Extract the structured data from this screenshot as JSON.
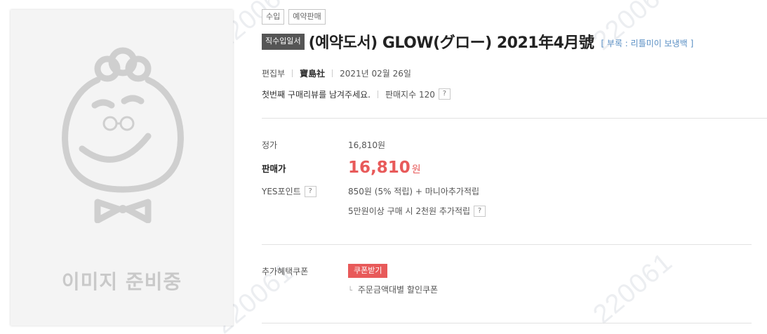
{
  "watermark": "220061",
  "cover": {
    "placeholder_text": "이미지 준비중"
  },
  "badges": [
    "수입",
    "예약판매"
  ],
  "title_block": {
    "tag": "직수입일서",
    "title": "(예약도서) GLOW(グロー) 2021年4月號",
    "subtitle": "[ 부록 : 리틀미이 보냉백 ]"
  },
  "meta": {
    "author": "편집부",
    "publisher": "寶島社",
    "date": "2021년 02월 26일"
  },
  "review": {
    "link": "첫번째 구매리뷰를 남겨주세요.",
    "sales_index": "판매지수 120",
    "help": "?"
  },
  "pricing": {
    "list_label": "정가",
    "list_price": "16,810원",
    "sale_label": "판매가",
    "sale_price": "16,810",
    "sale_unit": "원",
    "points_label": "YES포인트",
    "points_help": "?",
    "points_value": "850원 (5% 적립) + 마니아추가적립",
    "points_extra": "5만원이상 구매 시 2천원 추가적립",
    "points_extra_help": "?"
  },
  "coupon": {
    "label": "추가혜택쿠폰",
    "button": "쿠폰받기",
    "sub_mark": "└",
    "sub_text": "주문금액대별 할인쿠폰"
  },
  "colors": {
    "accent_red": "#e85a5a",
    "link_blue": "#5a8fc4",
    "tag_dark": "#555555"
  }
}
